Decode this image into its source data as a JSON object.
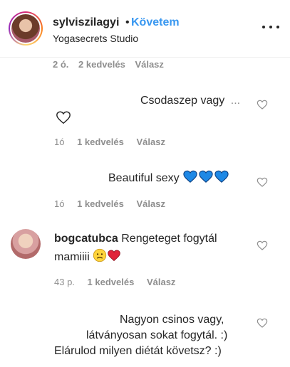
{
  "header": {
    "username": "sylviszilagyi",
    "separator": "•",
    "follow_label": "Követem",
    "location": "Yogasecrets Studio",
    "more_icon": "more-options-icon"
  },
  "faded_meta": {
    "time": "2 ó.",
    "likes": "2 kedvelés",
    "reply": "Válasz"
  },
  "comments": [
    {
      "text": "Csodaszep vagy",
      "ellipsis": "...",
      "time": "1ó",
      "likes": "1 kedvelés",
      "reply": "Válasz"
    },
    {
      "text": "Beautiful sexy",
      "time": "1ó",
      "likes": "1 kedvelés",
      "reply": "Válasz"
    },
    {
      "username": "bogcatubca",
      "text_line1": "Rengeteget fogytál",
      "text_line2": "mamiiii",
      "time": "43 p.",
      "likes": "1 kedvelés",
      "reply": "Válasz"
    },
    {
      "line1": "Nagyon csinos vagy,",
      "line2": "látványosan sokat fogytál. :)",
      "line3": "Elárulod milyen diétát követsz? :)"
    }
  ],
  "colors": {
    "follow": "#3897f0",
    "muted": "#8e8e8e",
    "text": "#262626",
    "blue_heart": "#1e88e5",
    "red_heart": "#e0243a"
  }
}
